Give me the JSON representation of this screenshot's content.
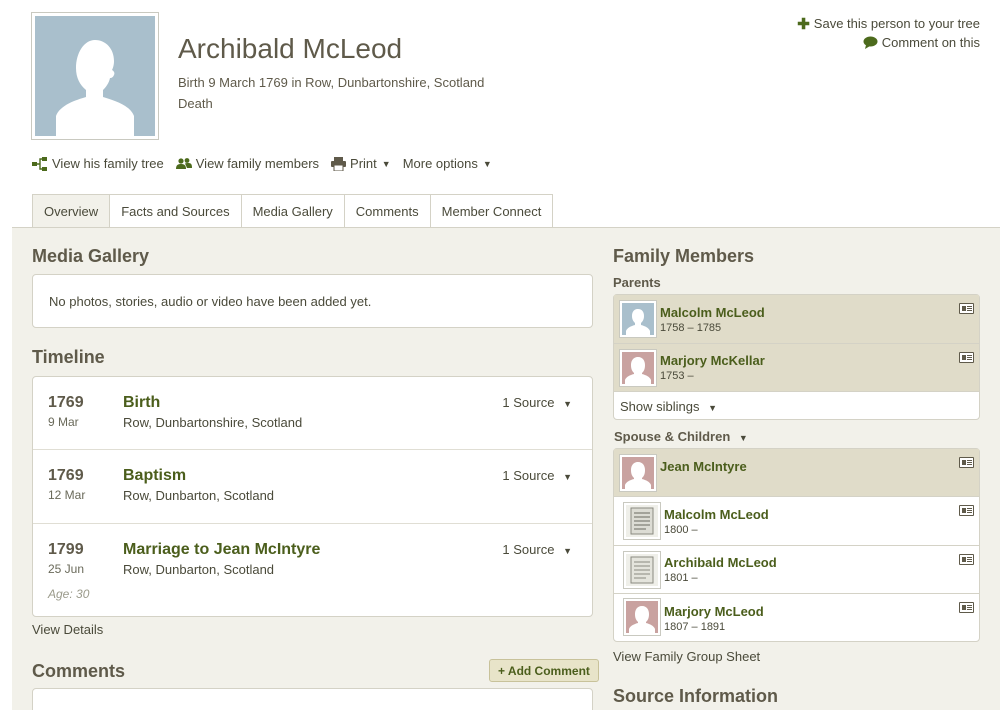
{
  "person": {
    "name": "Archibald McLeod",
    "birth": "Birth 9 March 1769 in Row, Dunbartonshire, Scotland",
    "death": "Death"
  },
  "top_actions": {
    "save": "Save this person to your tree",
    "comment": "Comment on this"
  },
  "tools": {
    "family_tree": "View his family tree",
    "family_members": "View family members",
    "print": "Print",
    "more": "More options"
  },
  "tabs": [
    "Overview",
    "Facts and Sources",
    "Media Gallery",
    "Comments",
    "Member Connect"
  ],
  "media_gallery": {
    "title": "Media Gallery",
    "empty": "No photos, stories, audio or video have been added yet."
  },
  "timeline": {
    "title": "Timeline",
    "items": [
      {
        "year": "1769",
        "date": "9 Mar",
        "event": "Birth",
        "place": "Row, Dunbartonshire, Scotland",
        "source": "1 Source"
      },
      {
        "year": "1769",
        "date": "12 Mar",
        "event": "Baptism",
        "place": "Row, Dunbarton, Scotland",
        "source": "1 Source"
      },
      {
        "year": "1799",
        "date": "25 Jun",
        "event": "Marriage to Jean McIntyre",
        "place": "Row, Dunbarton, Scotland",
        "source": "1 Source",
        "age": "Age: 30"
      }
    ],
    "view_details": "View Details"
  },
  "comments": {
    "title": "Comments",
    "add": "+ Add Comment"
  },
  "family": {
    "title": "Family Members",
    "parents_label": "Parents",
    "parents": [
      {
        "name": "Malcolm McLeod",
        "dates": "1758 – 1785",
        "gender": "male"
      },
      {
        "name": "Marjory McKellar",
        "dates": "1753 –",
        "gender": "female"
      }
    ],
    "show_siblings": "Show siblings",
    "spouse_label": "Spouse & Children",
    "spouse": {
      "name": "Jean McIntyre",
      "gender": "female"
    },
    "children": [
      {
        "name": "Malcolm McLeod",
        "dates": "1800 –"
      },
      {
        "name": "Archibald McLeod",
        "dates": "1801 –"
      },
      {
        "name": "Marjory McLeod",
        "dates": "1807 – 1891"
      }
    ],
    "group_sheet": "View Family Group Sheet"
  },
  "source_info": {
    "title": "Source Information"
  }
}
